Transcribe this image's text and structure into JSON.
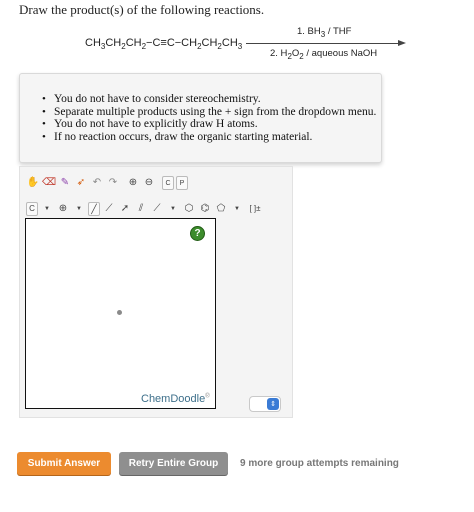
{
  "question": {
    "prompt": "Draw the product(s) of the following reactions."
  },
  "reaction": {
    "reactant_parts": [
      "CH",
      "3",
      "CH",
      "2",
      "CH",
      "2",
      "−C≡C−CH",
      "2",
      "CH",
      "2",
      "CH",
      "3"
    ],
    "condition_1_parts": [
      "1. BH",
      "3",
      " / THF"
    ],
    "condition_2_parts": [
      "2. H",
      "2",
      "O",
      "2",
      " / aqueous NaOH"
    ]
  },
  "notes": [
    "You do not have to consider stereochemistry.",
    "Separate multiple products using the + sign from the dropdown menu.",
    "You do not have to explicitly draw H atoms.",
    "If no reaction occurs, draw the organic starting material."
  ],
  "toolbar": {
    "row1": [
      "hand-icon",
      "eraser-icon",
      "pencil-icon",
      "undo-icon",
      "redo-icon",
      "zoom-in-icon",
      "zoom-out-icon",
      "clean-icon",
      "periodic-icon"
    ],
    "clean_label": "C",
    "periodic_label": "P",
    "element_label": "C",
    "bracket_label": "[ ]±"
  },
  "canvas": {
    "help_label": "?",
    "brand": "ChemDoodle",
    "brand_mark": "®"
  },
  "actions": {
    "submit_label": "Submit Answer",
    "retry_label": "Retry Entire Group",
    "attempts_text": "9 more group attempts remaining"
  },
  "colors": {
    "submit": "#ec8b2f",
    "retry": "#8f8f8f",
    "help": "#3c8c2c",
    "select_accent": "#3a7bd5"
  }
}
